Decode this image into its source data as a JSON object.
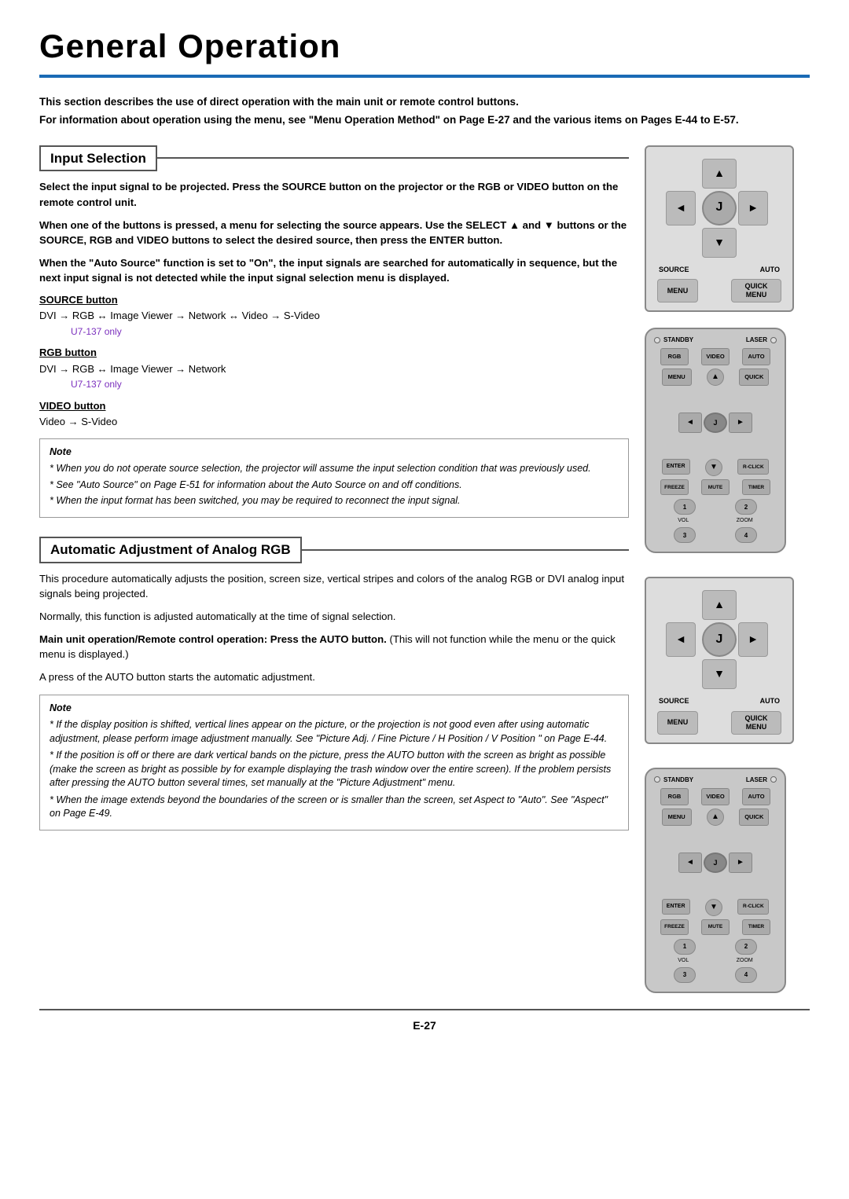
{
  "page": {
    "title": "General Operation",
    "page_number": "E-27"
  },
  "intro": {
    "line1": "This section describes the use of direct operation with the main unit or remote control buttons.",
    "line2": "For information about operation using the menu, see \"Menu Operation Method\" on Page E-27 and the various items on Pages E-44 to E-57."
  },
  "section1": {
    "title": "Input Selection",
    "paragraphs": [
      "Select the input signal to be projected. Press the SOURCE button on the projector or the RGB or VIDEO button on the remote control unit.",
      "When one of the buttons is pressed, a menu for selecting the source appears. Use the SELECT ▲ and ▼ buttons or the SOURCE, RGB and VIDEO buttons to select the desired source, then press the ENTER button.",
      "When the \"Auto Source\" function is set to \"On\", the input signals are searched for automatically in sequence, but the next input signal is not detected while the input signal selection menu is displayed."
    ],
    "source_button": {
      "label": "SOURCE button",
      "desc": "DVI → RGB ↔ Image Viewer → Network ↔ Video → S-Video",
      "note": "U7-137 only"
    },
    "rgb_button": {
      "label": "RGB button",
      "desc": "DVI → RGB ↔ Image Viewer → Network",
      "note": "U7-137 only"
    },
    "video_button": {
      "label": "VIDEO button",
      "desc": "Video → S-Video"
    },
    "notes": [
      "When you do not operate source selection, the projector will assume the input selection condition that was previously used.",
      "See \"Auto Source\" on Page E-51 for information about the Auto Source on and off conditions.",
      "When the input format has been switched, you may be required to reconnect the input signal."
    ]
  },
  "section2": {
    "title": "Automatic Adjustment of Analog RGB",
    "paragraphs": [
      "This procedure automatically adjusts the position, screen size, vertical stripes and colors of the analog RGB or DVI analog input signals being projected.",
      "Normally, this function is adjusted automatically at the time of signal selection.",
      "Main unit operation/Remote control operation: Press the AUTO button. (This will not function while the menu or the quick menu is displayed.)",
      "A press of the AUTO button starts the automatic adjustment."
    ],
    "notes": [
      "If the display position is shifted, vertical lines appear on the picture, or the projection is not good even after using automatic adjustment, please perform image adjustment manually. See \"Picture Adj. / Fine Picture / H Position / V Position \" on Page E-44.",
      "If the position is off or there are dark vertical bands on the picture, press the AUTO button with the screen as bright as possible (make the screen as bright as possible by for example displaying the trash window over the entire screen). If the problem persists after pressing the AUTO button several times, set manually at the \"Picture Adjustment\" menu.",
      "When the image extends beyond the boundaries of the screen or is smaller than the screen, set Aspect to \"Auto\". See \"Aspect\" on Page E-49."
    ]
  },
  "projector_panel": {
    "buttons": {
      "up": "▲",
      "down": "▼",
      "left": "◄",
      "right": "►",
      "center": "J"
    },
    "labels": {
      "source": "SOURCE",
      "auto": "AUTO",
      "menu": "MENU",
      "quick_menu": "QUICK MENU"
    }
  },
  "remote_control": {
    "labels": {
      "standby": "STANDBY",
      "laser": "LASER",
      "rgb": "RGB",
      "video": "VIDEO",
      "auto": "AUTO",
      "menu": "MENU",
      "quick": "QUICK",
      "enter": "ENTER",
      "r_click": "R-CLICK",
      "freeze": "FREEZE",
      "mute": "MUTE",
      "timer": "TIMER",
      "vol": "VOL",
      "zoom": "ZOOM"
    }
  }
}
